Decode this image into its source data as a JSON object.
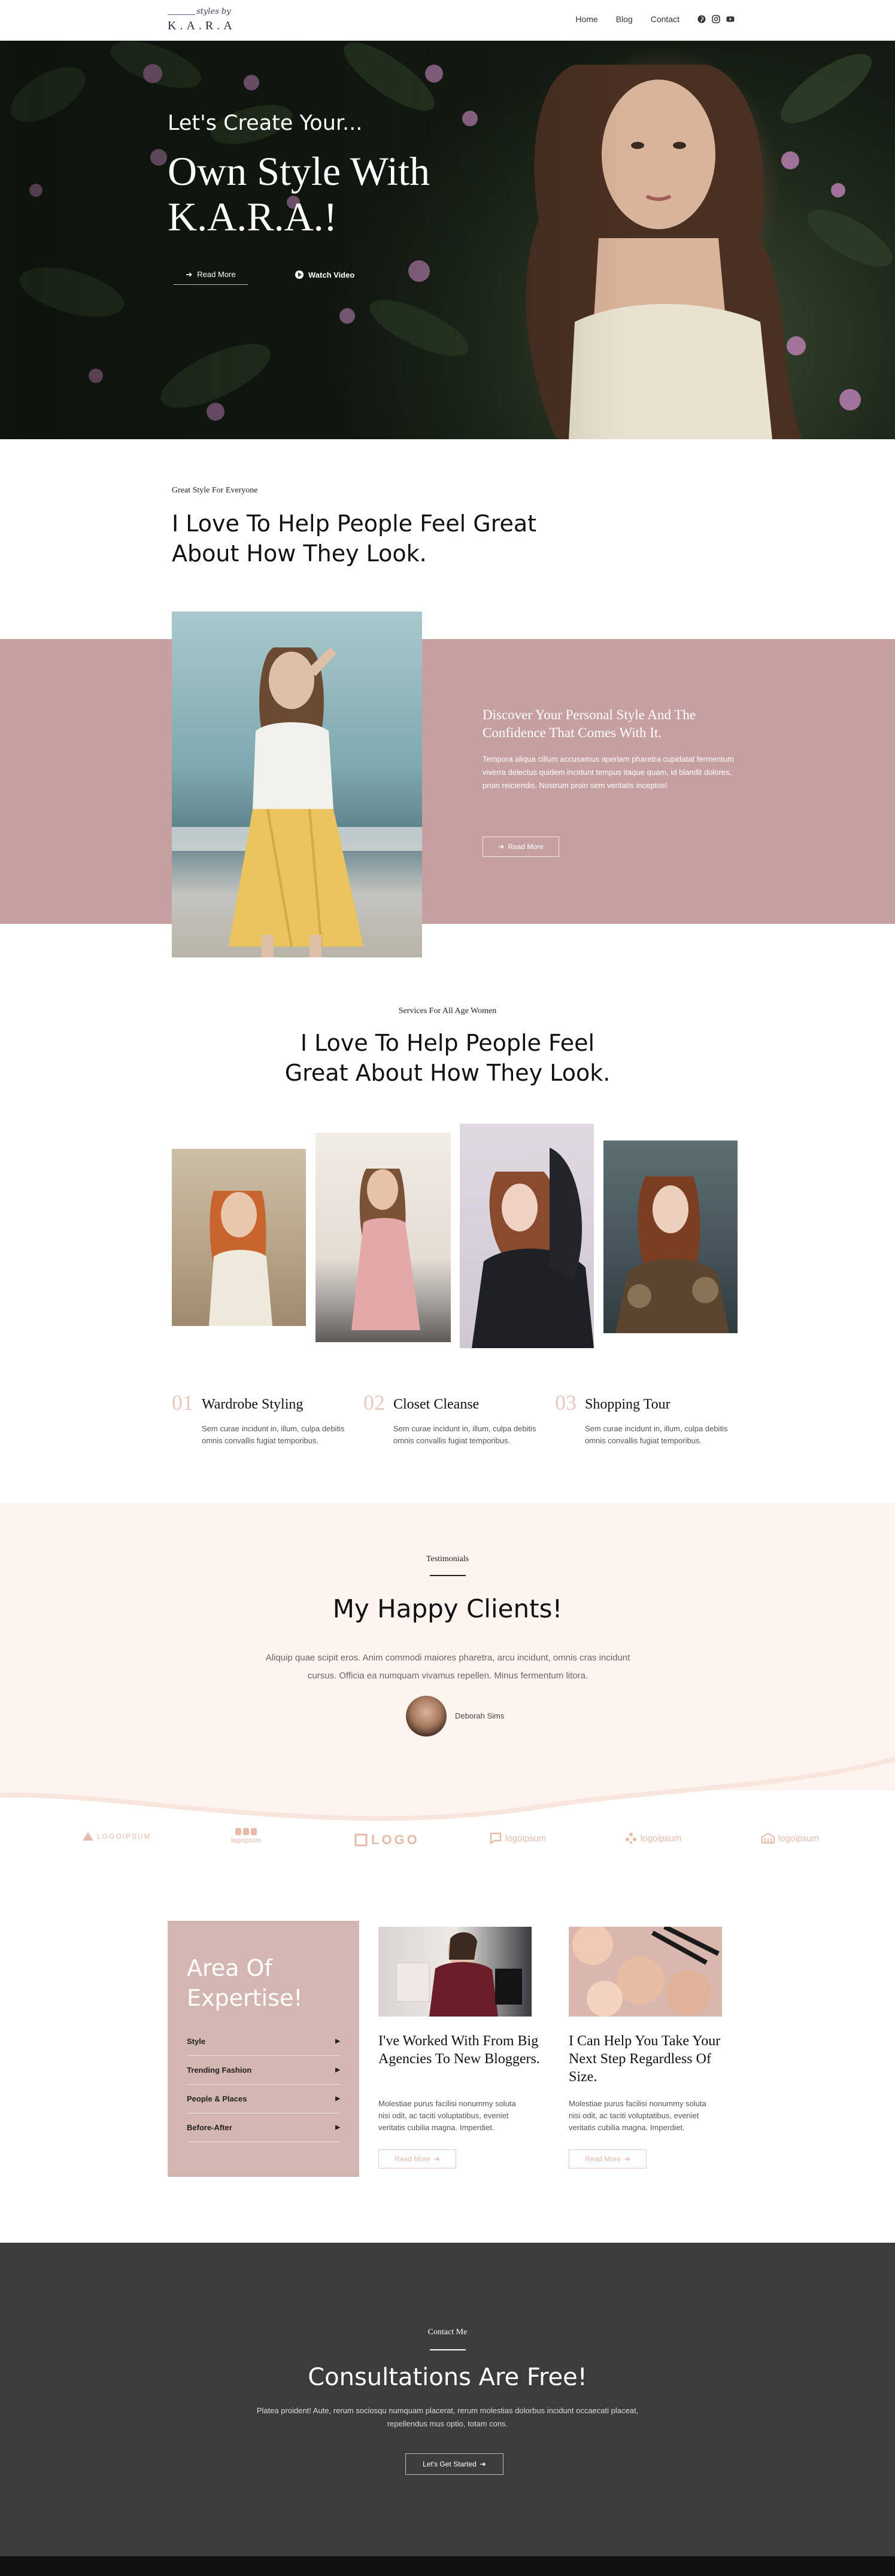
{
  "header": {
    "logo_script": "styles by",
    "logo_text": "K.A.R.A",
    "nav": [
      {
        "label": "Home"
      },
      {
        "label": "Blog"
      },
      {
        "label": "Contact"
      }
    ],
    "social": [
      "pinterest-icon",
      "instagram-icon",
      "youtube-icon"
    ]
  },
  "hero": {
    "kicker": "Let's Create Your...",
    "title_line1": "Own Style With",
    "title_line2": "K.A.R.A.!",
    "read_more": "Read More",
    "watch_video": "Watch Video"
  },
  "intro": {
    "kicker": "Great Style For Everyone",
    "title": "I Love To Help People Feel Great About How They Look."
  },
  "feature": {
    "title": "Discover Your Personal Style And The Confidence That Comes With It.",
    "text": "Tempora aliqua cillum accusamus aperiam pharetra cupidatat fermentum viverra delectus quidem incidunt tempus itaque quam, id blandit dolores, proin reiciendis. Nostrum proin sem veritatis inceptos!",
    "button": "Read More"
  },
  "services": {
    "kicker": "Services For All Age Women",
    "title": "I Love To Help People Feel Great About How They Look.",
    "items": [
      {
        "num": "01",
        "name": "Wardrobe Styling",
        "desc": "Sem curae incidunt in, illum, culpa debitis omnis convallis fugiat temporibus."
      },
      {
        "num": "02",
        "name": "Closet Cleanse",
        "desc": "Sem curae incidunt in, illum, culpa debitis omnis convallis fugiat temporibus."
      },
      {
        "num": "03",
        "name": "Shopping Tour",
        "desc": "Sem curae incidunt in, illum, culpa debitis omnis convallis fugiat temporibus."
      }
    ]
  },
  "testimonials": {
    "kicker": "Testimonials",
    "title": "My Happy Clients!",
    "quote": "Aliquip quae scipit eros. Anim commodi maiores pharetra, arcu incidunt, omnis cras incidunt cursus. Officia ea numquam vivamus repellen. Minus fermentum litora.",
    "name": "Deborah Sims"
  },
  "logos": [
    "LOGOIPSUM",
    "logoipsum",
    "LOGO",
    "logoipsum",
    "logoipsum",
    "logoipsum"
  ],
  "expertise": {
    "title": "Area Of Expertise!",
    "items": [
      "Style",
      "Trending Fashion",
      "People & Places",
      "Before-After"
    ]
  },
  "cards": [
    {
      "title": "I've Worked With From Big Agencies To New Bloggers.",
      "text": "Molestiae purus facilisi nonummy soluta nisi odit, ac taciti voluptatibus, eveniet veritatis cubilia magna. Imperdiet.",
      "button": "Read More"
    },
    {
      "title": "I Can Help You Take Your Next Step Regardless Of Size.",
      "text": "Molestiae purus facilisi nonummy soluta nisi odit, ac taciti voluptatibus, eveniet veritatis cubilia magna. Imperdiet.",
      "button": "Read More"
    }
  ],
  "contact": {
    "kicker": "Contact Me",
    "title": "Consultations Are Free!",
    "text": "Platea proident! Aute, rerum sociosqu numquam placerat, rerum molestias dolorbus incidunt occaecati placeat, repellendus mus optio, totam cons.",
    "button": "Let's Get Started"
  },
  "colors": {
    "accent_pink": "#c6a0a0",
    "expertise_bg": "#d4b6b1",
    "testimonial_bg": "#fdf3ef",
    "contact_bg": "#3d3c3c",
    "number_pink": "#e8c8c0"
  }
}
